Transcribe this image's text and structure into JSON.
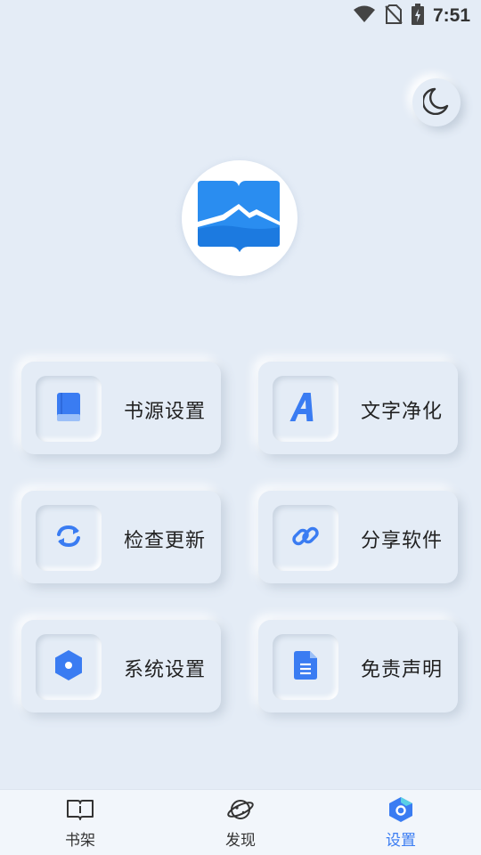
{
  "status_bar": {
    "time": "7:51",
    "icons": [
      "wifi-icon",
      "no-sim-icon",
      "battery-charging-icon"
    ]
  },
  "theme_toggle": {
    "icon": "moon-icon"
  },
  "logo": {
    "icon": "book-mountain-logo-icon",
    "brand_color": "#2a8df0"
  },
  "menu": {
    "items": [
      {
        "label": "书源设置",
        "icon": "book-icon"
      },
      {
        "label": "文字净化",
        "icon": "letter-a-icon"
      },
      {
        "label": "检查更新",
        "icon": "refresh-icon"
      },
      {
        "label": "分享软件",
        "icon": "link-icon"
      },
      {
        "label": "系统设置",
        "icon": "hexagon-settings-icon"
      },
      {
        "label": "免责声明",
        "icon": "document-icon"
      }
    ]
  },
  "bottom_nav": {
    "items": [
      {
        "label": "书架",
        "icon": "bookshelf-icon",
        "active": false
      },
      {
        "label": "发现",
        "icon": "planet-icon",
        "active": false
      },
      {
        "label": "设置",
        "icon": "settings-hexagon-icon",
        "active": true
      }
    ]
  },
  "colors": {
    "accent": "#3a7cf2",
    "background": "#e4ecf6"
  }
}
